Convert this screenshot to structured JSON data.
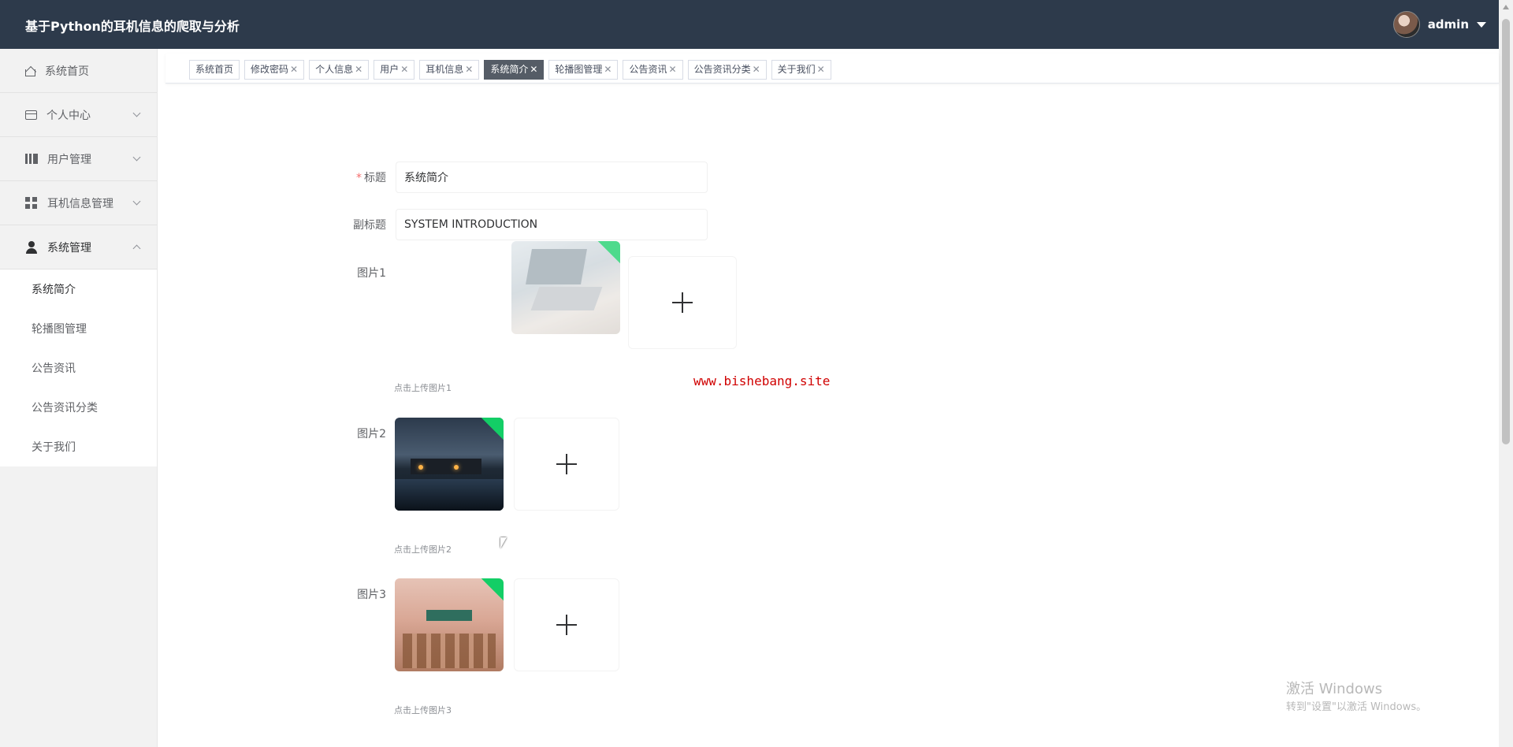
{
  "header": {
    "title": "基于Python的耳机信息的爬取与分析",
    "user": "admin"
  },
  "sidebar": {
    "items": [
      {
        "label": "系统首页",
        "icon": "home-icon"
      },
      {
        "label": "个人中心",
        "icon": "card-icon"
      },
      {
        "label": "用户管理",
        "icon": "books-icon"
      },
      {
        "label": "耳机信息管理",
        "icon": "grid-icon"
      },
      {
        "label": "系统管理",
        "icon": "person-icon"
      }
    ],
    "submenu": [
      "系统简介",
      "轮播图管理",
      "公告资讯",
      "公告资讯分类",
      "关于我们"
    ]
  },
  "tags": [
    {
      "label": "系统首页",
      "closable": false
    },
    {
      "label": "修改密码",
      "closable": true
    },
    {
      "label": "个人信息",
      "closable": true
    },
    {
      "label": "用户",
      "closable": true
    },
    {
      "label": "耳机信息",
      "closable": true
    },
    {
      "label": "系统简介",
      "closable": true,
      "active": true
    },
    {
      "label": "轮播图管理",
      "closable": true
    },
    {
      "label": "公告资讯",
      "closable": true
    },
    {
      "label": "公告资讯分类",
      "closable": true
    },
    {
      "label": "关于我们",
      "closable": true
    }
  ],
  "tag_close_glyph": "✕",
  "form": {
    "title_label": "标题",
    "title_required_mark": "*",
    "title_value": "系统简介",
    "subtitle_label": "副标题",
    "subtitle_value": "SYSTEM INTRODUCTION",
    "image1_label": "图片1",
    "image1_hint": "点击上传图片1",
    "image2_label": "图片2",
    "image2_hint": "点击上传图片2",
    "image3_label": "图片3",
    "image3_hint": "点击上传图片3"
  },
  "watermark": "www.bishebang.site",
  "windows_activation": {
    "line1": "激活 Windows",
    "line2": "转到\"设置\"以激活 Windows。"
  },
  "colors": {
    "header_bg": "#2d3a4b",
    "active_tag": "#555c66",
    "success_corner": "#13ce66",
    "watermark": "#d00000"
  }
}
